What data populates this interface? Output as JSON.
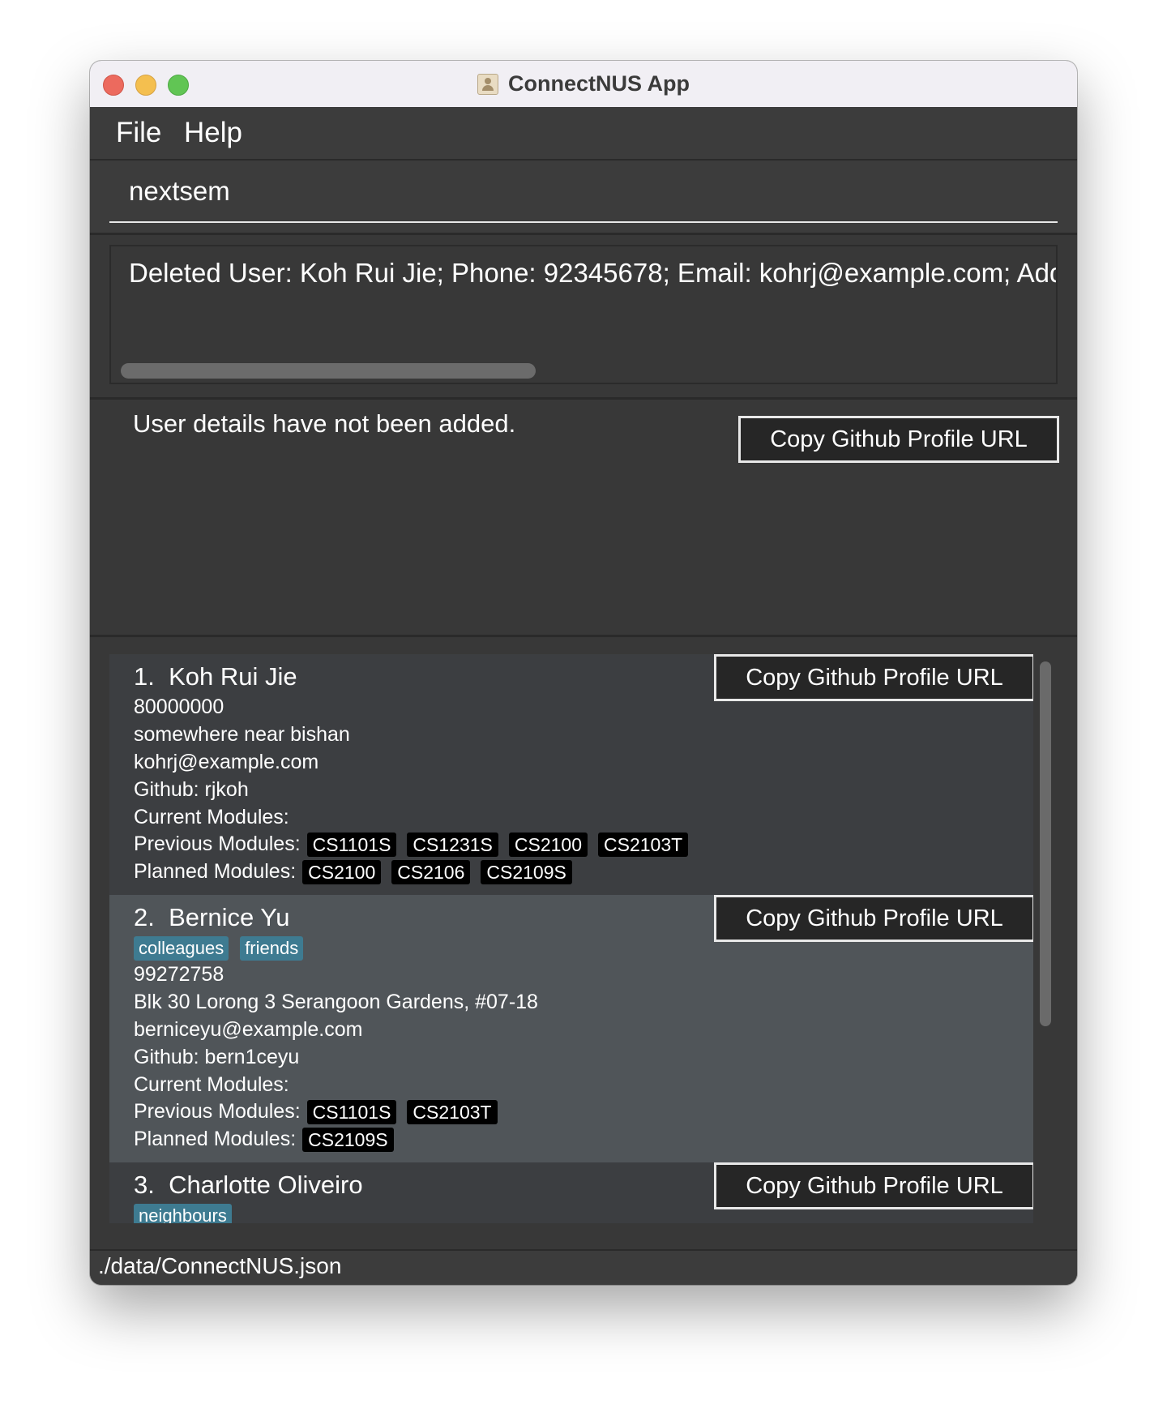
{
  "window": {
    "title": "ConnectNUS App",
    "icon": "contact-card-icon"
  },
  "menu": {
    "items": [
      "File",
      "Help"
    ]
  },
  "command_box": {
    "value": "nextsem",
    "placeholder": ""
  },
  "result_display": {
    "text": "Deleted User: Koh Rui Jie; Phone: 92345678; Email: kohrj@example.com; Address: somewhere near bishan"
  },
  "user_detail": {
    "message": "User details have not been added.",
    "copy_button_label": "Copy Github Profile URL"
  },
  "persons": [
    {
      "index": "1.",
      "name": "Koh Rui Jie",
      "tags": [],
      "phone": "80000000",
      "address": "somewhere near bishan",
      "email": "kohrj@example.com",
      "github": "Github: rjkoh",
      "current_label": "Current Modules:",
      "current_modules": [],
      "previous_label": "Previous Modules:",
      "previous_modules": [
        "CS1101S",
        "CS1231S",
        "CS2100",
        "CS2103T"
      ],
      "planned_label": "Planned Modules:",
      "planned_modules": [
        "CS2100",
        "CS2106",
        "CS2109S"
      ],
      "copy_button_label": "Copy Github Profile URL"
    },
    {
      "index": "2.",
      "name": "Bernice Yu",
      "tags": [
        "colleagues",
        "friends"
      ],
      "phone": "99272758",
      "address": "Blk 30 Lorong 3 Serangoon Gardens, #07-18",
      "email": "berniceyu@example.com",
      "github": "Github: bern1ceyu",
      "current_label": "Current Modules:",
      "current_modules": [],
      "previous_label": "Previous Modules:",
      "previous_modules": [
        "CS1101S",
        "CS2103T"
      ],
      "planned_label": "Planned Modules:",
      "planned_modules": [
        "CS2109S"
      ],
      "copy_button_label": "Copy Github Profile URL"
    },
    {
      "index": "3.",
      "name": "Charlotte Oliveiro",
      "tags": [
        "neighbours"
      ],
      "copy_button_label": "Copy Github Profile URL"
    }
  ],
  "status_bar": {
    "path": "./data/ConnectNUS.json"
  },
  "colors": {
    "background": "#3c3c3c",
    "card_odd": "#3c3e41",
    "card_even": "#505559",
    "tag": "#3e7b91",
    "module_tag": "#000000"
  }
}
